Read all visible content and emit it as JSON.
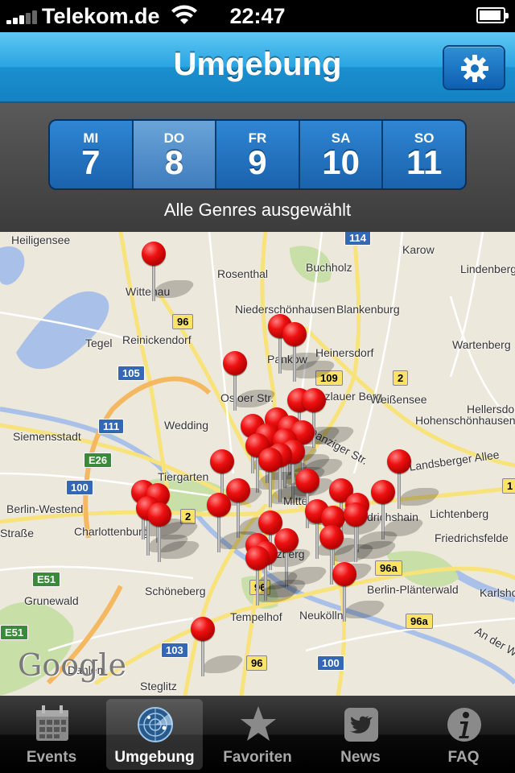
{
  "status_bar": {
    "carrier": "Telekom.de",
    "time": "22:47"
  },
  "nav": {
    "title": "Umgebung",
    "settings_icon": "gear-icon"
  },
  "date_picker": {
    "days": [
      {
        "name": "MI",
        "number": "7"
      },
      {
        "name": "DO",
        "number": "8",
        "selected": true
      },
      {
        "name": "FR",
        "number": "9"
      },
      {
        "name": "SA",
        "number": "10"
      },
      {
        "name": "SO",
        "number": "11"
      }
    ],
    "genre_filter": "Alle Genres ausgewählt"
  },
  "map": {
    "places": [
      "Heiligensee",
      "Wittenau",
      "Rosenthal",
      "Buchholz",
      "Karow",
      "Lindenberg",
      "Reinickendorf",
      "Niederschönhausen",
      "Blankenburg",
      "Tegel",
      "Pankow",
      "Heinersdorf",
      "Wartenberg",
      "Osloer Str.",
      "Prenzlauer Berg",
      "Weißensee",
      "Hohenschönhausen",
      "Siemensstadt",
      "Wedding",
      "Danziger Str.",
      "Tiergarten",
      "Landsberger Allee",
      "Berlin-Westend",
      "Mitte",
      "Lichtenberg",
      "Charlottenburg",
      "Friedrichshain",
      "Friedrichsfelde",
      "Kreuzberg",
      "Grunewald",
      "Schöneberg",
      "Berlin-Plänterwald",
      "Karlshorst",
      "Tempelhof",
      "Neukölln",
      "Dahlem",
      "Steglitz",
      "An der Wuhlheide",
      "Hellersdorf",
      "Straße"
    ],
    "roads": [
      "114",
      "96",
      "105",
      "109",
      "2",
      "111",
      "E26",
      "100",
      "2",
      "E51",
      "96a",
      "96a",
      "103",
      "96",
      "100",
      "96",
      "E51",
      "1"
    ],
    "attribution": "Google",
    "pin_count": 45
  },
  "tabs": [
    {
      "label": "Events",
      "icon": "calendar-icon"
    },
    {
      "label": "Umgebung",
      "icon": "radar-icon",
      "active": true
    },
    {
      "label": "Favoriten",
      "icon": "star-icon"
    },
    {
      "label": "News",
      "icon": "twitter-bird-icon"
    },
    {
      "label": "FAQ",
      "icon": "info-icon"
    }
  ]
}
